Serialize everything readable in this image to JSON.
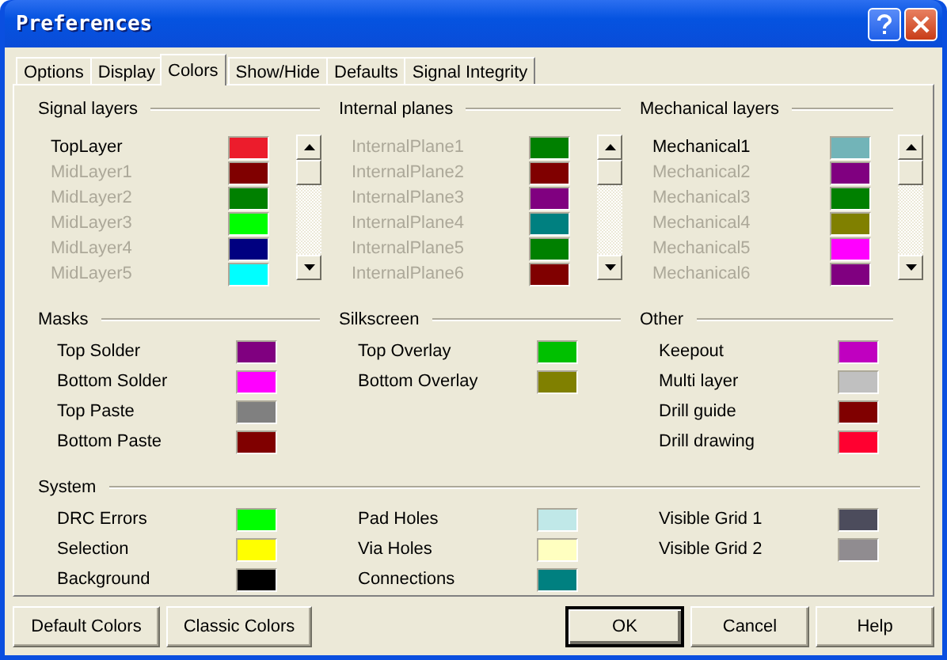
{
  "window": {
    "title": "Preferences"
  },
  "tabs": [
    {
      "label": "Options",
      "selected": false
    },
    {
      "label": "Display",
      "selected": false
    },
    {
      "label": "Colors",
      "selected": true
    },
    {
      "label": "Show/Hide",
      "selected": false
    },
    {
      "label": "Defaults",
      "selected": false
    },
    {
      "label": "Signal Integrity",
      "selected": false
    }
  ],
  "layer_groups": [
    {
      "title": "Signal layers",
      "layers": [
        {
          "name": "TopLayer",
          "enabled": true,
          "color": "#ec1c2c"
        },
        {
          "name": "MidLayer1",
          "enabled": false,
          "color": "#800000"
        },
        {
          "name": "MidLayer2",
          "enabled": false,
          "color": "#008000"
        },
        {
          "name": "MidLayer3",
          "enabled": false,
          "color": "#00ff00"
        },
        {
          "name": "MidLayer4",
          "enabled": false,
          "color": "#000080"
        },
        {
          "name": "MidLayer5",
          "enabled": false,
          "color": "#00ffff"
        }
      ]
    },
    {
      "title": "Internal planes",
      "layers": [
        {
          "name": "InternalPlane1",
          "enabled": false,
          "color": "#008000"
        },
        {
          "name": "InternalPlane2",
          "enabled": false,
          "color": "#800000"
        },
        {
          "name": "InternalPlane3",
          "enabled": false,
          "color": "#800080"
        },
        {
          "name": "InternalPlane4",
          "enabled": false,
          "color": "#008080"
        },
        {
          "name": "InternalPlane5",
          "enabled": false,
          "color": "#008000"
        },
        {
          "name": "InternalPlane6",
          "enabled": false,
          "color": "#800000"
        }
      ]
    },
    {
      "title": "Mechanical layers",
      "layers": [
        {
          "name": "Mechanical1",
          "enabled": true,
          "color": "#72b4b8"
        },
        {
          "name": "Mechanical2",
          "enabled": false,
          "color": "#800080"
        },
        {
          "name": "Mechanical3",
          "enabled": false,
          "color": "#008000"
        },
        {
          "name": "Mechanical4",
          "enabled": false,
          "color": "#808000"
        },
        {
          "name": "Mechanical5",
          "enabled": false,
          "color": "#ff00ff"
        },
        {
          "name": "Mechanical6",
          "enabled": false,
          "color": "#800080"
        }
      ]
    }
  ],
  "color_groups": [
    {
      "title": "Masks",
      "items": [
        {
          "name": "Top Solder",
          "color": "#800080"
        },
        {
          "name": "Bottom Solder",
          "color": "#ff00ff"
        },
        {
          "name": "Top Paste",
          "color": "#808080"
        },
        {
          "name": "Bottom Paste",
          "color": "#800000"
        }
      ]
    },
    {
      "title": "Silkscreen",
      "items": [
        {
          "name": "Top Overlay",
          "color": "#00c000"
        },
        {
          "name": "Bottom Overlay",
          "color": "#808000"
        }
      ]
    },
    {
      "title": "Other",
      "items": [
        {
          "name": "Keepout",
          "color": "#c000c0"
        },
        {
          "name": "Multi layer",
          "color": "#c0c0c0"
        },
        {
          "name": "Drill guide",
          "color": "#800000"
        },
        {
          "name": "Drill drawing",
          "color": "#ff0030"
        }
      ]
    }
  ],
  "system": {
    "title": "System",
    "columns": [
      {
        "items": [
          {
            "name": "DRC Errors",
            "color": "#00ff00"
          },
          {
            "name": "Selection",
            "color": "#ffff00"
          },
          {
            "name": "Background",
            "color": "#000000"
          }
        ]
      },
      {
        "items": [
          {
            "name": "Pad Holes",
            "color": "#c0e8e8"
          },
          {
            "name": "Via Holes",
            "color": "#ffffc0"
          },
          {
            "name": "Connections",
            "color": "#008080"
          }
        ]
      },
      {
        "items": [
          {
            "name": "Visible Grid 1",
            "color": "#4c4c5c"
          },
          {
            "name": "Visible Grid 2",
            "color": "#908c90"
          }
        ]
      }
    ]
  },
  "buttons": {
    "left": [
      {
        "label": "Default Colors",
        "default": false
      },
      {
        "label": "Classic Colors",
        "default": false
      }
    ],
    "right": [
      {
        "label": "OK",
        "default": true
      },
      {
        "label": "Cancel",
        "default": false
      },
      {
        "label": "Help",
        "default": false
      }
    ]
  }
}
